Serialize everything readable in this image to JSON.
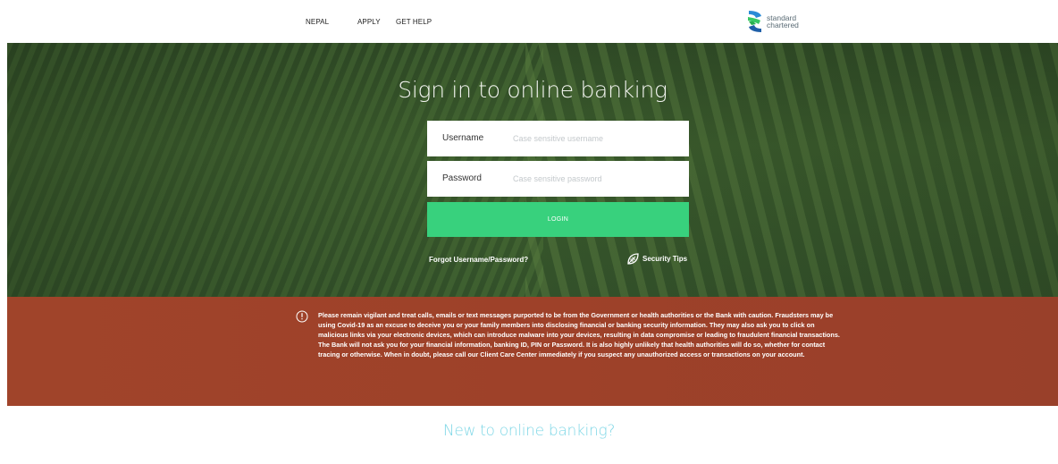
{
  "nav": {
    "country": "NEPAL",
    "apply": "APPLY",
    "help": "GET HELP"
  },
  "logo": {
    "line1": "standard",
    "line2": "chartered"
  },
  "hero": {
    "title": "Sign in to online banking"
  },
  "form": {
    "username_label": "Username",
    "username_placeholder": "Case sensitive username",
    "password_label": "Password",
    "password_placeholder": "Case sensitive password",
    "login_label": "LOGIN",
    "forgot_label": "Forgot Username/Password?",
    "tips_label": "Security Tips"
  },
  "warning": {
    "text": "Please remain vigilant and treat calls, emails or text messages purported to be from the Government or health authorities or the Bank with caution. Fraudsters may be using Covid-19 as an excuse to deceive you or your family members into disclosing financial or banking security information. They may also ask you to click on malicious links via your electronic devices, which can introduce malware into your devices, resulting in data compromise or leading to fraudulent financial transactions. The Bank will not ask you for your financial information, banking ID, PIN or Password. It is also highly unlikely that health authorities will do so, whether for contact tracing or otherwise. When in doubt, please call our Client Care Center immediately if you suspect any unauthorized access or transactions on your account."
  },
  "bottom": {
    "title": "New to online banking?"
  },
  "colors": {
    "login_button": "#38d17d",
    "warning_band": "#9e4129",
    "accent_title": "#7fd7e6"
  },
  "icons": {
    "warning": "info-circle-icon",
    "tips": "shield-leaf-icon"
  }
}
